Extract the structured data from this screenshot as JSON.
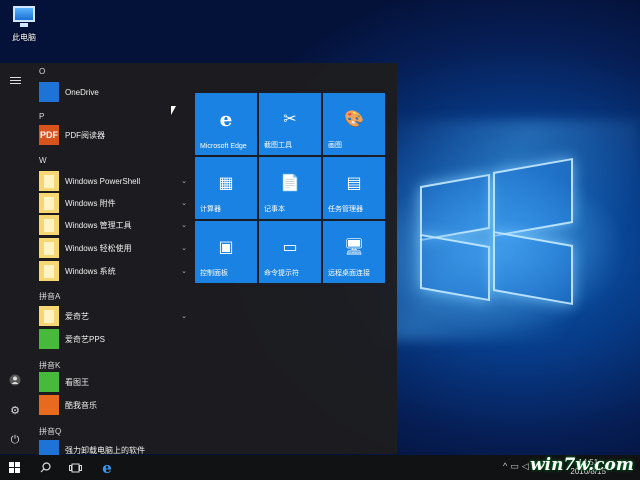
{
  "desktop": {
    "icon_label": "此电脑"
  },
  "start_menu": {
    "sections": [
      {
        "header": "O",
        "apps": [
          {
            "name": "OneDrive",
            "icon": "onedrive-icon",
            "expandable": false
          }
        ]
      },
      {
        "header": "P",
        "apps": [
          {
            "name": "PDF阅读器",
            "icon": "pdf-icon",
            "expandable": false
          }
        ]
      },
      {
        "header": "W",
        "apps": [
          {
            "name": "Windows PowerShell",
            "icon": "folder-icon",
            "expandable": true
          },
          {
            "name": "Windows 附件",
            "icon": "folder-icon",
            "expandable": true
          },
          {
            "name": "Windows 管理工具",
            "icon": "folder-icon",
            "expandable": true
          },
          {
            "name": "Windows 轻松使用",
            "icon": "folder-icon",
            "expandable": true
          },
          {
            "name": "Windows 系统",
            "icon": "folder-icon",
            "expandable": true
          }
        ]
      },
      {
        "header": "拼音A",
        "apps": [
          {
            "name": "爱奇艺",
            "icon": "folder-icon",
            "expandable": true
          },
          {
            "name": "爱奇艺PPS",
            "icon": "iqiyi-pps-icon",
            "expandable": false
          }
        ]
      },
      {
        "header": "拼音K",
        "apps": [
          {
            "name": "看图王",
            "icon": "image-viewer-icon",
            "expandable": false
          },
          {
            "name": "酷我音乐",
            "icon": "kuwo-music-icon",
            "expandable": false
          }
        ]
      },
      {
        "header": "拼音Q",
        "apps": [
          {
            "name": "强力卸载电脑上的软件",
            "icon": "uninstall-icon",
            "expandable": false
          }
        ]
      }
    ],
    "tiles": [
      {
        "label": "Microsoft Edge",
        "icon": "edge-icon",
        "glyph": "e"
      },
      {
        "label": "截图工具",
        "icon": "snipping-tool-icon",
        "glyph": "✂"
      },
      {
        "label": "画图",
        "icon": "paint-icon",
        "glyph": "🎨"
      },
      {
        "label": "计算器",
        "icon": "calculator-icon",
        "glyph": "▦"
      },
      {
        "label": "记事本",
        "icon": "notepad-icon",
        "glyph": "📄"
      },
      {
        "label": "任务管理器",
        "icon": "task-manager-icon",
        "glyph": "▤"
      },
      {
        "label": "控制面板",
        "icon": "control-panel-icon",
        "glyph": "▣"
      },
      {
        "label": "命令提示符",
        "icon": "cmd-icon",
        "glyph": "▭"
      },
      {
        "label": "远程桌面连接",
        "icon": "remote-desktop-icon",
        "glyph": "🖥"
      }
    ]
  },
  "taskbar": {
    "time": "14:51",
    "date": "2016/8/15"
  },
  "watermark": "win7w.com"
}
